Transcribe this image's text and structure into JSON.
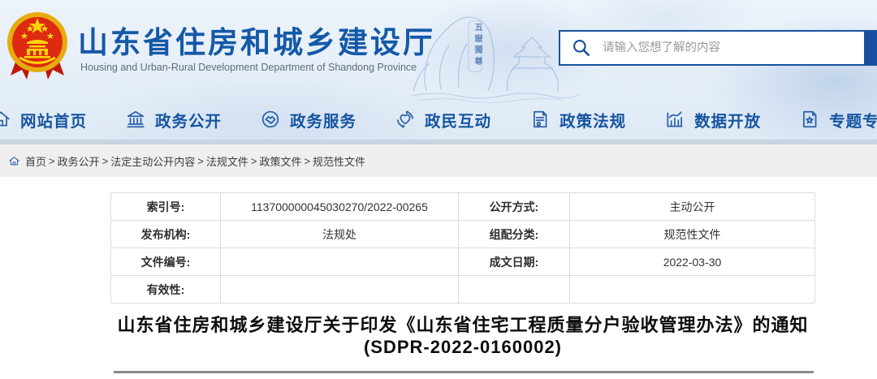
{
  "header": {
    "site_title": "山东省住房和城乡建设厅",
    "site_subtitle": "Housing and Urban-Rural Development Department of Shandong Province",
    "watermark_text": "五嶽獨尊",
    "search": {
      "placeholder": "请输入您想了解的内容"
    }
  },
  "nav": {
    "items": [
      {
        "label": "网站首页",
        "icon": "home-icon"
      },
      {
        "label": "政务公开",
        "icon": "government-building-icon"
      },
      {
        "label": "政务服务",
        "icon": "handshake-icon"
      },
      {
        "label": "政民互动",
        "icon": "heart-interaction-icon"
      },
      {
        "label": "政策法规",
        "icon": "policy-document-icon"
      },
      {
        "label": "数据开放",
        "icon": "data-chart-icon"
      },
      {
        "label": "专题专栏",
        "icon": "special-topics-icon"
      }
    ]
  },
  "breadcrumb": {
    "separator": ">",
    "items": [
      "首页",
      "政务公开",
      "法定主动公开内容",
      "法规文件",
      "政策文件",
      "规范性文件"
    ]
  },
  "meta_table": {
    "rows": [
      {
        "label1": "索引号:",
        "value1": "113700000045030270/2022-00265",
        "label2": "公开方式:",
        "value2": "主动公开"
      },
      {
        "label1": "发布机构:",
        "value1": "法规处",
        "label2": "组配分类:",
        "value2": "规范性文件"
      },
      {
        "label1": "文件编号:",
        "value1": "",
        "label2": "成文日期:",
        "value2": "2022-03-30"
      },
      {
        "label1": "有效性:",
        "value1": "",
        "label2": "",
        "value2": ""
      }
    ]
  },
  "document": {
    "title": "山东省住房和城乡建设厅关于印发《山东省住宅工程质量分户验收管理办法》的通知(SDPR-2022-0160002)"
  },
  "colors": {
    "accent_blue": "#15549f",
    "title_blue": "#1459a8",
    "emblem_red": "#dd2a10",
    "emblem_gold": "#f2c31a",
    "breadcrumb_bg": "#efefef",
    "rule_gray": "#8a8a8a"
  }
}
